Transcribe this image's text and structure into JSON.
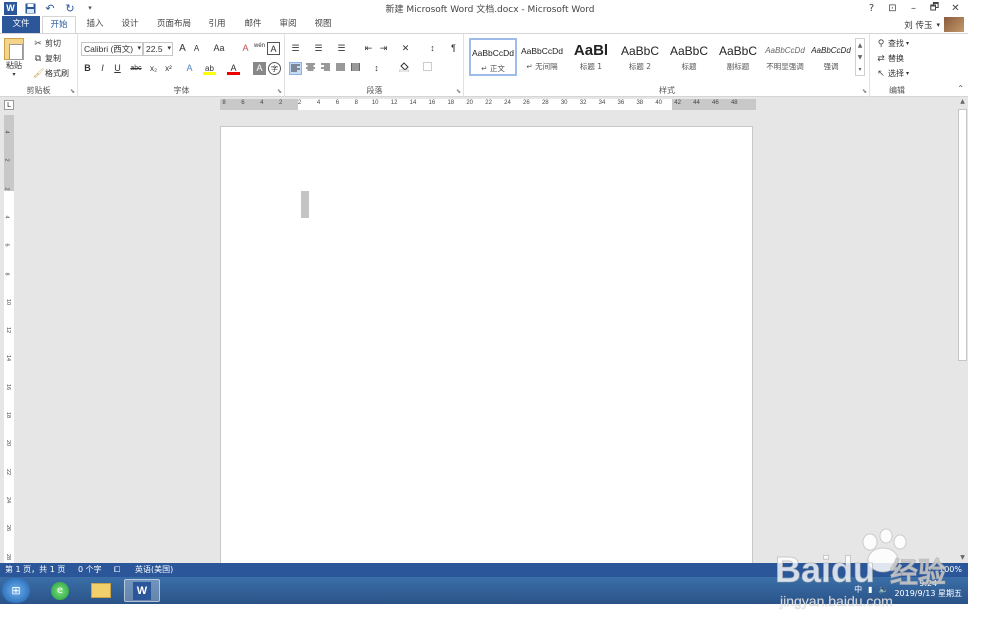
{
  "window": {
    "title": "新建 Microsoft Word 文档.docx - Microsoft Word",
    "help": "?",
    "ribbon_options": "⊡",
    "minimize": "–",
    "restore": "🗗",
    "close": "✕"
  },
  "qat": {
    "undo": "↶",
    "redo": "↻",
    "customize": "▾"
  },
  "tabs": [
    {
      "label": "文件"
    },
    {
      "label": "开始"
    },
    {
      "label": "插入"
    },
    {
      "label": "设计"
    },
    {
      "label": "页面布局"
    },
    {
      "label": "引用"
    },
    {
      "label": "邮件"
    },
    {
      "label": "审阅"
    },
    {
      "label": "视图"
    }
  ],
  "user": {
    "name": "刘 传玉",
    "dropdown": "▾"
  },
  "clipboard": {
    "paste": "粘贴",
    "cut": "剪切",
    "copy": "复制",
    "format_painter": "格式刷",
    "label": "剪贴板"
  },
  "font": {
    "name": "Calibri (西文)",
    "size": "22.5",
    "grow": "A",
    "shrink": "A",
    "case": "Aa",
    "clear": "A",
    "phonetic": "wén",
    "border_char": "A",
    "bold": "B",
    "italic": "I",
    "underline": "U",
    "strike": "abc",
    "subscript": "x₂",
    "superscript": "x²",
    "effects": "A",
    "highlight": "ab",
    "font_color": "A",
    "shading": "A",
    "enclose": "字",
    "label": "字体"
  },
  "paragraph": {
    "label": "段落",
    "bullets": "☰",
    "numbering": "☰",
    "multilevel": "☰",
    "decrease_indent": "⇤",
    "increase_indent": "⇥",
    "chinese_layout": "✕",
    "sort": "↕",
    "show_marks": "¶",
    "line_spacing": "↕"
  },
  "styles": {
    "label": "样式",
    "items": [
      {
        "sample": "AaBbCcDd",
        "name": "↵ 正文"
      },
      {
        "sample": "AaBbCcDd",
        "name": "↵ 无间隔"
      },
      {
        "sample": "AaBl",
        "name": "标题 1"
      },
      {
        "sample": "AaBbC",
        "name": "标题 2"
      },
      {
        "sample": "AaBbC",
        "name": "标题"
      },
      {
        "sample": "AaBbC",
        "name": "副标题"
      },
      {
        "sample": "AaBbCcDd",
        "name": "不明显强调"
      },
      {
        "sample": "AaBbCcDd",
        "name": "强调"
      }
    ]
  },
  "editing": {
    "find": "查找",
    "replace": "替换",
    "select": "选择",
    "label": "编辑"
  },
  "ruler": {
    "corner": "L",
    "ticks": [
      "8",
      "6",
      "4",
      "2",
      "2",
      "4",
      "6",
      "8",
      "10",
      "12",
      "14",
      "16",
      "18",
      "20",
      "22",
      "24",
      "26",
      "28",
      "30",
      "32",
      "34",
      "36",
      "38",
      "40",
      "42",
      "44",
      "46",
      "48"
    ],
    "vticks": [
      "4",
      "2",
      "2",
      "4",
      "6",
      "8",
      "10",
      "12",
      "14",
      "16",
      "18",
      "20",
      "22",
      "24",
      "26",
      "28"
    ]
  },
  "status": {
    "page": "第 1 页，共 1 页",
    "words": "0 个字",
    "language": "英语(美国)",
    "zoom": "100%"
  },
  "tray": {
    "ime": "中",
    "time": "9:24",
    "date": "2019/9/13 星期五"
  },
  "watermark": {
    "brand": "Baidu",
    "brand_cn": "经验",
    "url": "jingyan.baidu.com"
  }
}
